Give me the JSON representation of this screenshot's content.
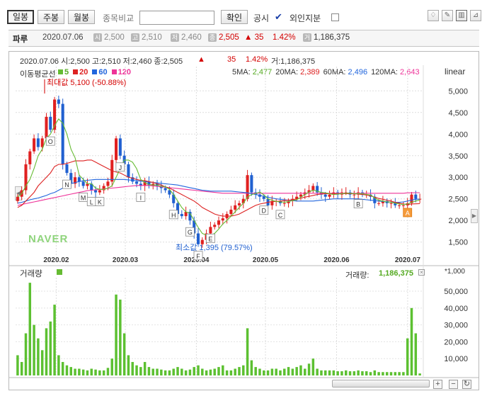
{
  "toolbar": {
    "tabs": [
      {
        "label": "일봉",
        "active": true
      },
      {
        "label": "주봉",
        "active": false
      },
      {
        "label": "월봉",
        "active": false
      }
    ],
    "compare_label": "종목비교",
    "compare_value": "",
    "confirm_label": "확인",
    "disclosure_label": "공시",
    "disclosure_checked": true,
    "foreign_label": "외인지분",
    "foreign_checked": false,
    "tool_icons": [
      "pointer-icon",
      "pencil-icon",
      "split-view-icon",
      "chart-settings-icon"
    ]
  },
  "info": {
    "name": "파루",
    "date": "2020.07.06",
    "open_icon": "시",
    "open": "2,500",
    "high_icon": "고",
    "high": "2,510",
    "low_icon": "저",
    "low": "2,460",
    "close_icon": "종",
    "close": "2,505",
    "change": "▲ 35",
    "change_pct": "1.42%",
    "volume_icon": "거",
    "volume": "1,186,375"
  },
  "chart_header": {
    "line": "2020.07.06 시:2,500 고:2,510 저:2,460 종:2,505",
    "change": "▲",
    "change_val": "35",
    "change_pct": "1.42%",
    "volume": "거:1,186,375"
  },
  "ma_legend": {
    "label": "이동평균선",
    "items": [
      {
        "name": "5",
        "color": "#66bb33"
      },
      {
        "name": "20",
        "color": "#dd2222"
      },
      {
        "name": "60",
        "color": "#2266dd"
      },
      {
        "name": "120",
        "color": "#ee3399"
      }
    ],
    "values": [
      {
        "label": "5MA:",
        "value": "2,477",
        "color": "#55aa22"
      },
      {
        "label": "20MA:",
        "value": "2,389",
        "color": "#dd2222"
      },
      {
        "label": "60MA:",
        "value": "2,496",
        "color": "#2266dd"
      },
      {
        "label": "120MA:",
        "value": "2,643",
        "color": "#ee3399"
      }
    ],
    "scale": "linear"
  },
  "annotations": {
    "max_label": "최대값 5,100 (-50.88%)",
    "min_label": "최소값 1,395 (79.57%)",
    "watermark": "NAVER"
  },
  "price_axis": [
    "5,000",
    "4,500",
    "4,000",
    "3,500",
    "3,000",
    "2,500",
    "2,000",
    "1,500"
  ],
  "date_axis": [
    "2020.02",
    "2020.03",
    "2020.04",
    "2020.05",
    "2020.06",
    "2020.07"
  ],
  "volume_panel": {
    "label": "거래량",
    "legend_label": "거래량:",
    "value": "1,186,375",
    "unit": "*1,000",
    "axis": [
      "50,000",
      "40,000",
      "30,000",
      "20,000",
      "10,000"
    ]
  },
  "markers": [
    "O",
    "N",
    "M",
    "L",
    "K",
    "J",
    "I",
    "H",
    "G",
    "F",
    "E",
    "D",
    "C",
    "B",
    "A"
  ],
  "chart_data": {
    "type": "candlestick",
    "x_ticks": [
      "2020.02",
      "2020.03",
      "2020.04",
      "2020.05",
      "2020.06",
      "2020.07"
    ],
    "ylim": [
      1200,
      5300
    ],
    "close": [
      2550,
      2700,
      3300,
      3600,
      3900,
      3700,
      3900,
      4400,
      4100,
      4800,
      4700,
      3300,
      3100,
      2850,
      3000,
      2900,
      2800,
      2850,
      2700,
      2650,
      2700,
      2800,
      2900,
      3400,
      3900,
      3500,
      3300,
      3000,
      2900,
      2850,
      2800,
      2900,
      2800,
      2850,
      2800,
      2750,
      2700,
      2600,
      2400,
      2150,
      2100,
      2200,
      2000,
      1700,
      1450,
      1550,
      1700,
      1850,
      1900,
      2000,
      2050,
      2150,
      2250,
      2350,
      2400,
      2500,
      3050,
      2650,
      2600,
      2550,
      2500,
      2350,
      2450,
      2450,
      2400,
      2400,
      2450,
      2500,
      2550,
      2600,
      2650,
      2700,
      2800,
      2650,
      2600,
      2550,
      2600,
      2650,
      2600,
      2650,
      2650,
      2600,
      2600,
      2650,
      2600,
      2600,
      2550,
      2400,
      2400,
      2450,
      2400,
      2400,
      2350,
      2350,
      2350,
      2400,
      2600,
      2500,
      2500
    ],
    "ma5": [
      2550,
      2620,
      2800,
      2950,
      3200,
      3500,
      3650,
      3900,
      4000,
      4200,
      4350,
      4250,
      4000,
      3650,
      3450,
      3050,
      2950,
      2850,
      2850,
      2750,
      2720,
      2720,
      2750,
      2800,
      3000,
      3200,
      3400,
      3400,
      3350,
      3200,
      2950,
      2880,
      2830,
      2820,
      2820,
      2790,
      2780,
      2720,
      2600,
      2450,
      2300,
      2200,
      2170,
      2000,
      1840,
      1700,
      1660,
      1660,
      1700,
      1800,
      1920,
      2000,
      2100,
      2200,
      2300,
      2400,
      2540,
      2600,
      2620,
      2660,
      2590,
      2500,
      2470,
      2440,
      2430,
      2420,
      2440,
      2460,
      2480,
      2540,
      2600,
      2660,
      2700,
      2680,
      2650,
      2640,
      2620,
      2600,
      2610,
      2620,
      2630,
      2630,
      2620,
      2620,
      2620,
      2600,
      2590,
      2520,
      2470,
      2450,
      2430,
      2420,
      2400,
      2380,
      2370,
      2380,
      2420,
      2450,
      2477
    ],
    "ma20": [
      2300,
      2350,
      2450,
      2550,
      2650,
      2800,
      2900,
      3000,
      3100,
      3250,
      3300,
      3300,
      3320,
      3350,
      3380,
      3380,
      3380,
      3400,
      3400,
      3350,
      3300,
      3250,
      3200,
      3150,
      3120,
      3100,
      3050,
      3000,
      2980,
      2950,
      2930,
      2920,
      2900,
      2880,
      2850,
      2820,
      2780,
      2750,
      2700,
      2650,
      2600,
      2550,
      2500,
      2450,
      2380,
      2300,
      2250,
      2200,
      2150,
      2120,
      2100,
      2100,
      2100,
      2120,
      2150,
      2200,
      2250,
      2300,
      2350,
      2380,
      2400,
      2420,
      2440,
      2440,
      2450,
      2460,
      2470,
      2480,
      2500,
      2520,
      2540,
      2560,
      2580,
      2600,
      2610,
      2620,
      2620,
      2620,
      2620,
      2620,
      2620,
      2620,
      2620,
      2610,
      2600,
      2590,
      2570,
      2540,
      2510,
      2490,
      2470,
      2450,
      2420,
      2400,
      2380,
      2370,
      2380,
      2385,
      2389
    ],
    "ma60": [
      2400,
      2420,
      2450,
      2480,
      2500,
      2520,
      2550,
      2580,
      2620,
      2650,
      2700,
      2750,
      2800,
      2850,
      2880,
      2900,
      2920,
      2930,
      2940,
      2950,
      2950,
      2950,
      2950,
      2950,
      2950,
      2950,
      2950,
      2940,
      2930,
      2920,
      2910,
      2900,
      2890,
      2880,
      2870,
      2860,
      2850,
      2840,
      2830,
      2820,
      2800,
      2780,
      2760,
      2740,
      2720,
      2700,
      2690,
      2680,
      2680,
      2680,
      2680,
      2680,
      2680,
      2670,
      2660,
      2650,
      2640,
      2620,
      2600,
      2580,
      2560,
      2540,
      2520,
      2500,
      2490,
      2480,
      2470,
      2460,
      2450,
      2450,
      2450,
      2450,
      2450,
      2460,
      2470,
      2480,
      2490,
      2500,
      2500,
      2500,
      2500,
      2500,
      2500,
      2500,
      2490,
      2480,
      2470,
      2460,
      2450,
      2440,
      2430,
      2420,
      2420,
      2420,
      2430,
      2450,
      2470,
      2490,
      2496
    ],
    "ma120": [
      2350,
      2370,
      2390,
      2410,
      2430,
      2450,
      2470,
      2490,
      2510,
      2530,
      2550,
      2570,
      2590,
      2610,
      2630,
      2650,
      2670,
      2690,
      2700,
      2710,
      2720,
      2730,
      2740,
      2750,
      2760,
      2770,
      2780,
      2790,
      2800,
      2810,
      2810,
      2810,
      2810,
      2800,
      2790,
      2780,
      2770,
      2760,
      2750,
      2740,
      2730,
      2720,
      2710,
      2700,
      2690,
      2680,
      2670,
      2660,
      2650,
      2640,
      2630,
      2630,
      2630,
      2630,
      2630,
      2630,
      2630,
      2630,
      2630,
      2630,
      2630,
      2630,
      2630,
      2630,
      2630,
      2630,
      2630,
      2630,
      2630,
      2630,
      2630,
      2630,
      2630,
      2630,
      2630,
      2630,
      2630,
      2630,
      2630,
      2630,
      2630,
      2630,
      2630,
      2630,
      2630,
      2630,
      2630,
      2630,
      2630,
      2630,
      2630,
      2630,
      2630,
      2630,
      2630,
      2640,
      2640,
      2643,
      2643
    ],
    "volume": [
      12000,
      8000,
      25000,
      55000,
      30000,
      22000,
      15000,
      28000,
      32000,
      42000,
      12000,
      8000,
      6000,
      5000,
      4000,
      4000,
      3500,
      3000,
      4000,
      3500,
      3000,
      3000,
      4500,
      10000,
      48000,
      45000,
      25000,
      12000,
      8000,
      6000,
      5000,
      8000,
      5000,
      4000,
      4000,
      3500,
      3000,
      3000,
      4000,
      5000,
      4000,
      3000,
      3500,
      5000,
      6000,
      4000,
      3000,
      3500,
      4000,
      5000,
      6000,
      3000,
      3000,
      4000,
      5000,
      6000,
      28000,
      9000,
      5000,
      4000,
      3000,
      3000,
      4000,
      4000,
      3000,
      4000,
      5000,
      4000,
      5000,
      6000,
      4000,
      7000,
      10000,
      4000,
      3000,
      3000,
      3000,
      3000,
      2500,
      2500,
      3000,
      2500,
      2500,
      3000,
      2500,
      2500,
      2000,
      3000,
      2000,
      2000,
      2000,
      2000,
      2000,
      2000,
      2000,
      22000,
      40000,
      25000,
      1186
    ]
  }
}
